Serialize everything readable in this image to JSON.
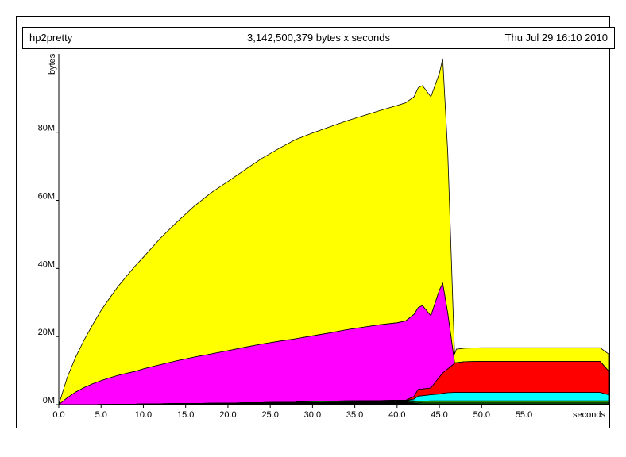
{
  "header": {
    "program": "hp2pretty",
    "total": "3,142,500,379 bytes x seconds",
    "date": "Thu Jul 29 16:10 2010"
  },
  "chart_data": {
    "type": "area",
    "stacked": true,
    "title": "",
    "xlabel": "seconds",
    "ylabel": "bytes",
    "xlim": [
      0,
      65
    ],
    "ylim": [
      0,
      103
    ],
    "y_unit": "M",
    "x_ticks": [
      "0.0",
      "5.0",
      "10.0",
      "15.0",
      "20.0",
      "25.0",
      "30.0",
      "35.0",
      "40.0",
      "45.0",
      "50.0",
      "55.0"
    ],
    "y_ticks": [
      "0M",
      "20M",
      "40M",
      "60M",
      "80M"
    ],
    "legend": "none",
    "x": [
      0,
      1,
      2,
      3,
      4,
      5,
      6,
      7,
      8,
      9,
      10,
      12,
      14,
      16,
      18,
      20,
      22,
      24,
      26,
      28,
      30,
      32,
      34,
      36,
      38,
      40,
      41,
      42,
      42.5,
      43,
      44,
      45,
      45.4,
      46,
      46.8,
      47,
      48,
      50,
      55,
      60,
      64,
      65
    ],
    "series": [
      {
        "color": "#000000",
        "values": [
          0,
          0,
          0,
          0,
          0,
          0.05,
          0.05,
          0.1,
          0.1,
          0.15,
          0.2,
          0.25,
          0.3,
          0.35,
          0.4,
          0.45,
          0.5,
          0.55,
          0.6,
          0.65,
          0.7,
          0.75,
          0.8,
          0.85,
          0.9,
          0.95,
          0.95,
          0.5,
          0.3,
          0.2,
          0.2,
          0.2,
          0.2,
          0.2,
          0.2,
          0.2,
          0.2,
          0.2,
          0.2,
          0.2,
          0.2,
          0.2
        ]
      },
      {
        "color": "#00c000",
        "values": [
          0,
          0,
          0,
          0,
          0,
          0,
          0,
          0,
          0,
          0,
          0,
          0,
          0,
          0,
          0,
          0,
          0.05,
          0.05,
          0.1,
          0.1,
          0.3,
          0.3,
          0.3,
          0.3,
          0.3,
          0.3,
          0.3,
          0.3,
          0.3,
          0.3,
          0.3,
          0.3,
          0.3,
          0.3,
          0.3,
          0.3,
          0.3,
          0.3,
          0.3,
          0.3,
          0.3,
          0.3
        ]
      },
      {
        "color": "#2a8a00",
        "values": [
          0,
          0,
          0,
          0,
          0,
          0,
          0,
          0,
          0,
          0,
          0,
          0,
          0,
          0,
          0,
          0,
          0,
          0,
          0,
          0,
          0,
          0,
          0,
          0,
          0,
          0,
          0,
          0.3,
          0.4,
          0.5,
          0.6,
          0.6,
          0.6,
          0.6,
          0.6,
          0.6,
          0.6,
          0.6,
          0.6,
          0.6,
          0.6,
          0.6
        ]
      },
      {
        "color": "#00ffff",
        "values": [
          0,
          0,
          0,
          0,
          0,
          0,
          0,
          0,
          0,
          0,
          0,
          0,
          0,
          0,
          0,
          0,
          0,
          0,
          0,
          0,
          0,
          0,
          0,
          0,
          0,
          0,
          0,
          0.5,
          1.5,
          1.6,
          1.8,
          2.0,
          2.2,
          2.4,
          2.5,
          2.5,
          2.5,
          2.5,
          2.5,
          2.5,
          2.5,
          1.8
        ]
      },
      {
        "color": "#ff0000",
        "values": [
          0,
          0,
          0,
          0,
          0,
          0,
          0,
          0,
          0,
          0,
          0,
          0,
          0,
          0,
          0,
          0,
          0,
          0,
          0,
          0,
          0,
          0,
          0,
          0,
          0,
          0,
          0,
          0.8,
          2.0,
          2.0,
          2.0,
          5.0,
          6.0,
          7.0,
          8.5,
          8.7,
          9.0,
          9.1,
          9.1,
          9.1,
          9.1,
          7.0
        ]
      },
      {
        "color": "#ff00ff",
        "values": [
          0,
          2.0,
          3.7,
          5.0,
          6.1,
          7.0,
          7.8,
          8.5,
          9.1,
          9.6,
          10.3,
          11.5,
          12.6,
          13.6,
          14.5,
          15.4,
          16.3,
          17.2,
          17.9,
          18.6,
          19.2,
          20.0,
          20.9,
          21.6,
          22.3,
          22.8,
          23.3,
          24.1,
          24.0,
          24.5,
          21.2,
          25.5,
          26.3,
          16.3,
          0.2,
          0,
          0,
          0,
          0,
          0,
          0,
          0
        ]
      },
      {
        "color": "#ffff00",
        "values": [
          0,
          6.0,
          10.3,
          14.0,
          17.4,
          20.6,
          23.4,
          26.1,
          28.5,
          30.9,
          32.8,
          37.1,
          40.8,
          44.3,
          47.3,
          49.7,
          52.1,
          54.5,
          56.6,
          58.5,
          59.6,
          60.5,
          61.3,
          62.1,
          62.9,
          63.8,
          64.1,
          63.9,
          64.6,
          64.6,
          64.3,
          63.7,
          66.0,
          47.0,
          2.5,
          4.0,
          4.0,
          4.0,
          4.0,
          4.0,
          4.0,
          5.0
        ]
      }
    ]
  }
}
